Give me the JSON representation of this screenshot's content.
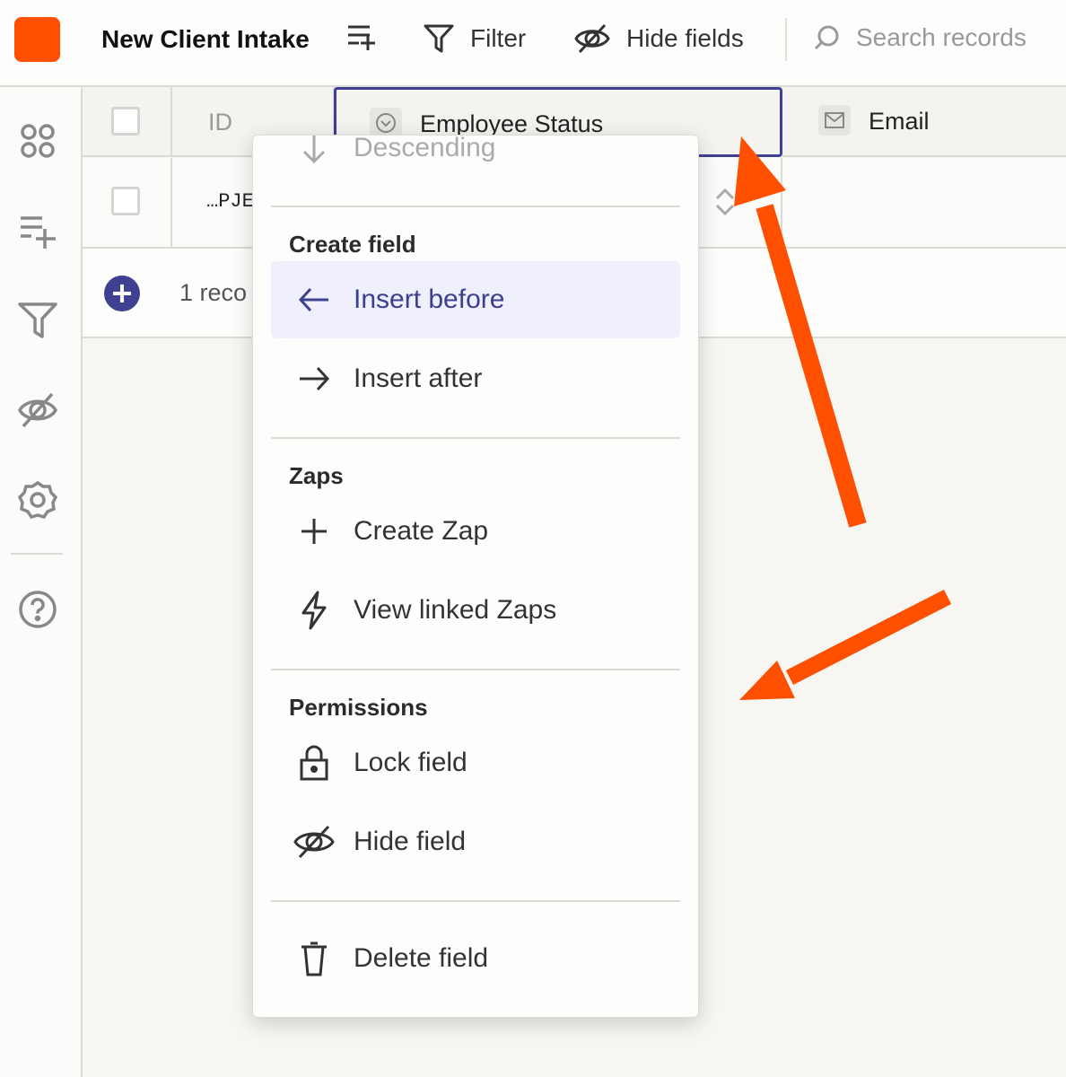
{
  "colors": {
    "brand": "#ff4f00",
    "accent": "#3d418f",
    "annotation_arrow": "#ff4f00"
  },
  "topbar": {
    "title": "New Client Intake",
    "add_field_icon": "add-field-icon",
    "filter_label": "Filter",
    "hide_fields_label": "Hide fields",
    "search_placeholder": "Search records"
  },
  "sidebar": {
    "items": [
      "apps-icon",
      "add-field-icon",
      "filter-icon",
      "hide-icon",
      "settings-icon",
      "help-icon"
    ]
  },
  "table": {
    "columns": [
      {
        "label": "ID"
      },
      {
        "label": "Employee Status"
      },
      {
        "label": "Email"
      }
    ],
    "rows": [
      {
        "id": "…PJE"
      }
    ],
    "footer_text": "1 reco"
  },
  "menu": {
    "partial_item": "Descending",
    "sections": [
      {
        "heading": "Create field",
        "items": [
          {
            "label": "Insert before",
            "icon": "arrow-left-icon",
            "active": true
          },
          {
            "label": "Insert after",
            "icon": "arrow-right-icon"
          }
        ]
      },
      {
        "heading": "Zaps",
        "items": [
          {
            "label": "Create Zap",
            "icon": "plus-icon"
          },
          {
            "label": "View linked Zaps",
            "icon": "bolt-icon"
          }
        ]
      },
      {
        "heading": "Permissions",
        "items": [
          {
            "label": "Lock field",
            "icon": "lock-icon"
          },
          {
            "label": "Hide field",
            "icon": "eye-off-icon"
          }
        ]
      },
      {
        "heading": "",
        "items": [
          {
            "label": "Delete field",
            "icon": "trash-icon"
          }
        ]
      }
    ]
  }
}
